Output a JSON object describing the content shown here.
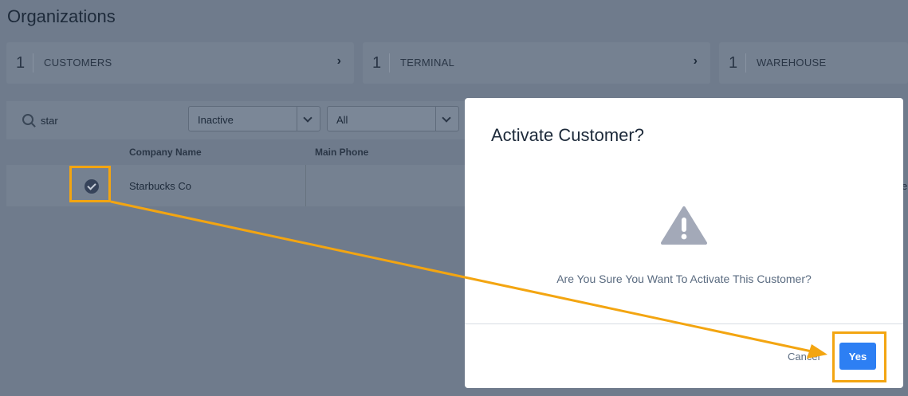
{
  "page": {
    "title": "Organizations"
  },
  "cards": [
    {
      "count": "1",
      "label": "CUSTOMERS"
    },
    {
      "count": "1",
      "label": "TERMINAL"
    },
    {
      "count": "1",
      "label": "WAREHOUSE"
    }
  ],
  "filters": {
    "search_value": "star",
    "status_select": "Inactive",
    "type_select": "All"
  },
  "table": {
    "columns": [
      "Company Name",
      "Main Phone"
    ],
    "rows": [
      {
        "company_name": "Starbucks Co"
      }
    ],
    "edge_text": "e"
  },
  "modal": {
    "title": "Activate Customer?",
    "message": "Are You Sure You Want To Activate This Customer?",
    "cancel_label": "Cancel",
    "yes_label": "Yes"
  },
  "colors": {
    "overlay": "#6f7b8c",
    "primary": "#2d7ff3",
    "highlight": "#f3a511"
  }
}
